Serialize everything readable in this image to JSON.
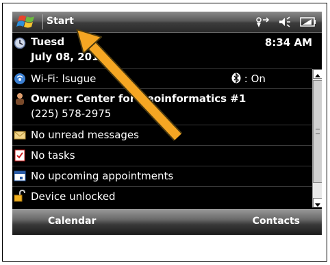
{
  "title_bar": {
    "start_label": "Start",
    "icons": [
      "connectivity-icon",
      "speaker-icon",
      "battery-icon"
    ]
  },
  "today": {
    "day": "Tuesd",
    "date": "July 08, 2014",
    "time": "8:34 AM"
  },
  "wifi": {
    "label": "Wi-Fi: lsugue",
    "bluetooth_status": ": On"
  },
  "owner": {
    "name": "Owner: Center for Geoinformatics #1",
    "phone": "(225) 578-2975"
  },
  "messages": {
    "label": "No unread messages"
  },
  "tasks": {
    "label": "No tasks"
  },
  "appointments": {
    "label": "No upcoming appointments"
  },
  "device": {
    "label": "Device unlocked"
  },
  "soft_keys": {
    "left": "Calendar",
    "right": "Contacts"
  },
  "colors": {
    "annotation_arrow": "#f5a623",
    "background": "#000000",
    "text": "#ffffff"
  }
}
